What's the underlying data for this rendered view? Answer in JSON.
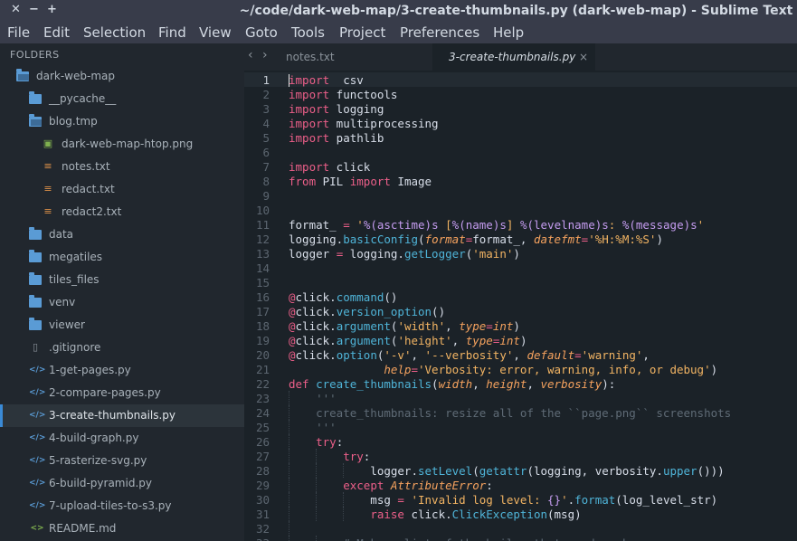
{
  "window": {
    "title": "~/code/dark-web-map/3-create-thumbnails.py (dark-web-map) - Sublime Text",
    "controls": [
      "✕",
      "−",
      "+"
    ]
  },
  "menu": [
    "File",
    "Edit",
    "Selection",
    "Find",
    "View",
    "Goto",
    "Tools",
    "Project",
    "Preferences",
    "Help"
  ],
  "sidebar": {
    "header": "FOLDERS",
    "items": [
      {
        "label": "dark-web-map",
        "kind": "folder-open",
        "depth": 0
      },
      {
        "label": "__pycache__",
        "kind": "folder",
        "depth": 1
      },
      {
        "label": "blog.tmp",
        "kind": "folder-open",
        "depth": 1
      },
      {
        "label": "dark-web-map-htop.png",
        "kind": "image",
        "depth": 2
      },
      {
        "label": "notes.txt",
        "kind": "text",
        "depth": 2
      },
      {
        "label": "redact.txt",
        "kind": "text",
        "depth": 2
      },
      {
        "label": "redact2.txt",
        "kind": "text",
        "depth": 2
      },
      {
        "label": "data",
        "kind": "folder",
        "depth": 1
      },
      {
        "label": "megatiles",
        "kind": "folder",
        "depth": 1
      },
      {
        "label": "tiles_files",
        "kind": "folder",
        "depth": 1
      },
      {
        "label": "venv",
        "kind": "folder",
        "depth": 1
      },
      {
        "label": "viewer",
        "kind": "folder",
        "depth": 1
      },
      {
        "label": ".gitignore",
        "kind": "file",
        "depth": 1
      },
      {
        "label": "1-get-pages.py",
        "kind": "code",
        "depth": 1
      },
      {
        "label": "2-compare-pages.py",
        "kind": "code",
        "depth": 1
      },
      {
        "label": "3-create-thumbnails.py",
        "kind": "code",
        "depth": 1,
        "selected": true
      },
      {
        "label": "4-build-graph.py",
        "kind": "code",
        "depth": 1
      },
      {
        "label": "5-rasterize-svg.py",
        "kind": "code",
        "depth": 1
      },
      {
        "label": "6-build-pyramid.py",
        "kind": "code",
        "depth": 1
      },
      {
        "label": "7-upload-tiles-to-s3.py",
        "kind": "code",
        "depth": 1
      },
      {
        "label": "README.md",
        "kind": "markdown",
        "depth": 1
      }
    ]
  },
  "tabs": [
    {
      "label": "notes.txt",
      "active": false
    },
    {
      "label": "3-create-thumbnails.py",
      "active": true,
      "close": "×"
    }
  ],
  "nav": {
    "back": "‹",
    "forward": "›"
  },
  "editor": {
    "current_line": 1,
    "lines": [
      {
        "n": "1",
        "indent": 0,
        "tokens": [
          [
            "kw",
            "import"
          ],
          [
            "",
            "  csv"
          ]
        ]
      },
      {
        "n": "2",
        "indent": 0,
        "tokens": [
          [
            "kw",
            "import"
          ],
          [
            "",
            " functools"
          ]
        ]
      },
      {
        "n": "3",
        "indent": 0,
        "tokens": [
          [
            "kw",
            "import"
          ],
          [
            "",
            " logging"
          ]
        ]
      },
      {
        "n": "4",
        "indent": 0,
        "tokens": [
          [
            "kw",
            "import"
          ],
          [
            "",
            " multiprocessing"
          ]
        ]
      },
      {
        "n": "5",
        "indent": 0,
        "tokens": [
          [
            "kw",
            "import"
          ],
          [
            "",
            " pathlib"
          ]
        ]
      },
      {
        "n": "6",
        "indent": 0,
        "tokens": []
      },
      {
        "n": "7",
        "indent": 0,
        "tokens": [
          [
            "kw",
            "import"
          ],
          [
            "",
            " click"
          ]
        ]
      },
      {
        "n": "8",
        "indent": 0,
        "tokens": [
          [
            "kw",
            "from"
          ],
          [
            "",
            " PIL "
          ],
          [
            "kw",
            "import"
          ],
          [
            "",
            " Image"
          ]
        ]
      },
      {
        "n": "9",
        "indent": 0,
        "tokens": []
      },
      {
        "n": "10",
        "indent": 0,
        "tokens": []
      },
      {
        "n": "11",
        "indent": 0,
        "tokens": [
          [
            "",
            "format_ "
          ],
          [
            "kw",
            "="
          ],
          [
            "",
            " "
          ],
          [
            "st",
            "'"
          ],
          [
            "bi",
            "%(asctime)s"
          ],
          [
            "st",
            " ["
          ],
          [
            "bi",
            "%(name)s"
          ],
          [
            "st",
            "] "
          ],
          [
            "bi",
            "%(levelname)s"
          ],
          [
            "st",
            ": "
          ],
          [
            "bi",
            "%(message)s"
          ],
          [
            "st",
            "'"
          ]
        ]
      },
      {
        "n": "12",
        "indent": 0,
        "tokens": [
          [
            "",
            "logging."
          ],
          [
            "fn",
            "basicConfig"
          ],
          [
            "",
            "("
          ],
          [
            "pr",
            "format"
          ],
          [
            "kw",
            "="
          ],
          [
            "",
            "format_, "
          ],
          [
            "pr",
            "datefmt"
          ],
          [
            "kw",
            "="
          ],
          [
            "st",
            "'%H:%M:%S'"
          ],
          [
            "",
            ")"
          ]
        ]
      },
      {
        "n": "13",
        "indent": 0,
        "tokens": [
          [
            "",
            "logger "
          ],
          [
            "kw",
            "="
          ],
          [
            "",
            " logging."
          ],
          [
            "fn",
            "getLogger"
          ],
          [
            "",
            "("
          ],
          [
            "st",
            "'main'"
          ],
          [
            "",
            ")"
          ]
        ]
      },
      {
        "n": "14",
        "indent": 0,
        "tokens": []
      },
      {
        "n": "15",
        "indent": 0,
        "tokens": []
      },
      {
        "n": "16",
        "indent": 0,
        "tokens": [
          [
            "dec",
            "@"
          ],
          [
            "",
            "click."
          ],
          [
            "fn",
            "command"
          ],
          [
            "",
            "()"
          ]
        ]
      },
      {
        "n": "17",
        "indent": 0,
        "tokens": [
          [
            "dec",
            "@"
          ],
          [
            "",
            "click."
          ],
          [
            "fn",
            "version_option"
          ],
          [
            "",
            "()"
          ]
        ]
      },
      {
        "n": "18",
        "indent": 0,
        "tokens": [
          [
            "dec",
            "@"
          ],
          [
            "",
            "click."
          ],
          [
            "fn",
            "argument"
          ],
          [
            "",
            "("
          ],
          [
            "st",
            "'width'"
          ],
          [
            "",
            ", "
          ],
          [
            "pr",
            "type"
          ],
          [
            "kw",
            "="
          ],
          [
            "ex",
            "int"
          ],
          [
            "",
            ")"
          ]
        ]
      },
      {
        "n": "19",
        "indent": 0,
        "tokens": [
          [
            "dec",
            "@"
          ],
          [
            "",
            "click."
          ],
          [
            "fn",
            "argument"
          ],
          [
            "",
            "("
          ],
          [
            "st",
            "'height'"
          ],
          [
            "",
            ", "
          ],
          [
            "pr",
            "type"
          ],
          [
            "kw",
            "="
          ],
          [
            "ex",
            "int"
          ],
          [
            "",
            ")"
          ]
        ]
      },
      {
        "n": "20",
        "indent": 0,
        "tokens": [
          [
            "dec",
            "@"
          ],
          [
            "",
            "click."
          ],
          [
            "fn",
            "option"
          ],
          [
            "",
            "("
          ],
          [
            "st",
            "'-v'"
          ],
          [
            "",
            ", "
          ],
          [
            "st",
            "'--verbosity'"
          ],
          [
            "",
            ", "
          ],
          [
            "pr",
            "default"
          ],
          [
            "kw",
            "="
          ],
          [
            "st",
            "'warning'"
          ],
          [
            "",
            ","
          ]
        ]
      },
      {
        "n": "21",
        "indent": 0,
        "tokens": [
          [
            "",
            "              "
          ],
          [
            "pr",
            "help"
          ],
          [
            "kw",
            "="
          ],
          [
            "st",
            "'Verbosity: error, warning, info, or debug'"
          ],
          [
            "",
            ")"
          ]
        ]
      },
      {
        "n": "22",
        "indent": 0,
        "tokens": [
          [
            "kw",
            "def"
          ],
          [
            "",
            " "
          ],
          [
            "df",
            "create_thumbnails"
          ],
          [
            "",
            "("
          ],
          [
            "pr",
            "width"
          ],
          [
            "",
            ", "
          ],
          [
            "pr",
            "height"
          ],
          [
            "",
            ", "
          ],
          [
            "pr",
            "verbosity"
          ],
          [
            "",
            "):"
          ]
        ]
      },
      {
        "n": "23",
        "indent": 1,
        "tokens": [
          [
            "cm",
            "    '''"
          ]
        ]
      },
      {
        "n": "24",
        "indent": 1,
        "tokens": [
          [
            "cm",
            "    create_thumbnails: resize all of the ``page.png`` screenshots"
          ]
        ]
      },
      {
        "n": "25",
        "indent": 1,
        "tokens": [
          [
            "cm",
            "    '''"
          ]
        ]
      },
      {
        "n": "26",
        "indent": 1,
        "tokens": [
          [
            "",
            "    "
          ],
          [
            "kw",
            "try"
          ],
          [
            "",
            ":"
          ]
        ]
      },
      {
        "n": "27",
        "indent": 2,
        "tokens": [
          [
            "",
            "        "
          ],
          [
            "kw",
            "try"
          ],
          [
            "",
            ":"
          ]
        ]
      },
      {
        "n": "28",
        "indent": 3,
        "tokens": [
          [
            "",
            "            logger."
          ],
          [
            "fn",
            "setLevel"
          ],
          [
            "",
            "("
          ],
          [
            "fn",
            "getattr"
          ],
          [
            "",
            "(logging, verbosity."
          ],
          [
            "fn",
            "upper"
          ],
          [
            "",
            "()))"
          ]
        ]
      },
      {
        "n": "29",
        "indent": 2,
        "tokens": [
          [
            "",
            "        "
          ],
          [
            "kw",
            "except"
          ],
          [
            "",
            " "
          ],
          [
            "ex",
            "AttributeError"
          ],
          [
            "",
            ":"
          ]
        ]
      },
      {
        "n": "30",
        "indent": 3,
        "tokens": [
          [
            "",
            "            msg "
          ],
          [
            "kw",
            "="
          ],
          [
            "",
            " "
          ],
          [
            "st",
            "'Invalid log level: "
          ],
          [
            "bi",
            "{}"
          ],
          [
            "st",
            "'"
          ],
          [
            "",
            "."
          ],
          [
            "fn",
            "format"
          ],
          [
            "",
            "(log_level_str)"
          ]
        ]
      },
      {
        "n": "31",
        "indent": 3,
        "tokens": [
          [
            "",
            "            "
          ],
          [
            "kw",
            "raise"
          ],
          [
            "",
            " click."
          ],
          [
            "fn",
            "ClickException"
          ],
          [
            "",
            "(msg)"
          ]
        ]
      },
      {
        "n": "32",
        "indent": 1,
        "tokens": []
      },
      {
        "n": "33",
        "indent": 2,
        "tokens": [
          [
            "cm",
            "        # Make a list of the heiles that need work."
          ]
        ]
      }
    ]
  }
}
